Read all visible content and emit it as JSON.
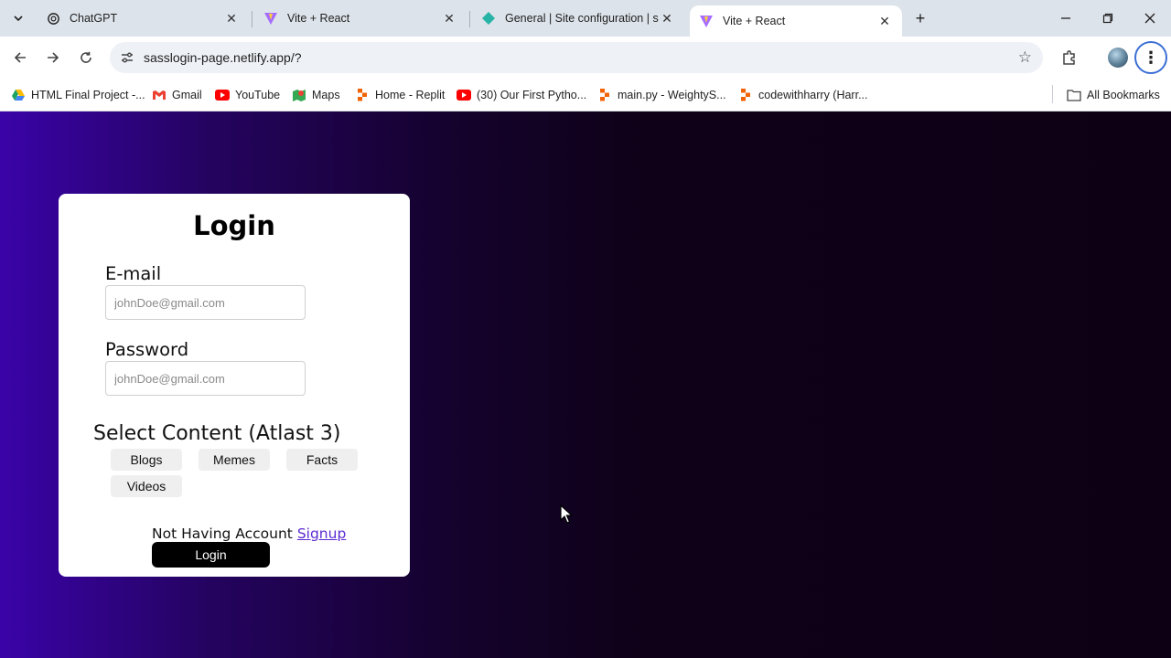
{
  "browser": {
    "tabs": [
      {
        "title": "ChatGPT",
        "icon": "openai-icon"
      },
      {
        "title": "Vite + React",
        "icon": "vite-icon"
      },
      {
        "title": "General | Site configuration | su",
        "icon": "netlify-icon"
      },
      {
        "title": "Vite + React",
        "icon": "vite-icon",
        "active": true
      }
    ],
    "url": "sasslogin-page.netlify.app/?",
    "bookmarks": [
      {
        "label": "HTML Final Project -...",
        "icon": "google-drive-icon"
      },
      {
        "label": "Gmail",
        "icon": "gmail-icon"
      },
      {
        "label": "YouTube",
        "icon": "youtube-icon"
      },
      {
        "label": "Maps",
        "icon": "google-maps-icon"
      },
      {
        "label": "Home - Replit",
        "icon": "replit-icon"
      },
      {
        "label": "(30) Our First Pytho...",
        "icon": "youtube-icon"
      },
      {
        "label": "main.py - WeightyS...",
        "icon": "replit-icon"
      },
      {
        "label": "codewithharry (Harr...",
        "icon": "replit-icon"
      }
    ],
    "all_bookmarks": "All Bookmarks"
  },
  "login": {
    "title": "Login",
    "email_label": "E-mail",
    "email_placeholder": "johnDoe@gmail.com",
    "password_label": "Password",
    "password_placeholder": "johnDoe@gmail.com",
    "select_title": "Select Content (Atlast 3)",
    "chips": [
      "Blogs",
      "Memes",
      "Facts",
      "Videos"
    ],
    "account_text": "Not Having Account",
    "signup_link": "Signup",
    "login_button": "Login"
  },
  "colors": {
    "gradient_start": "#3a03a8",
    "gradient_end": "#0e0014",
    "link": "#5b2bd0"
  }
}
